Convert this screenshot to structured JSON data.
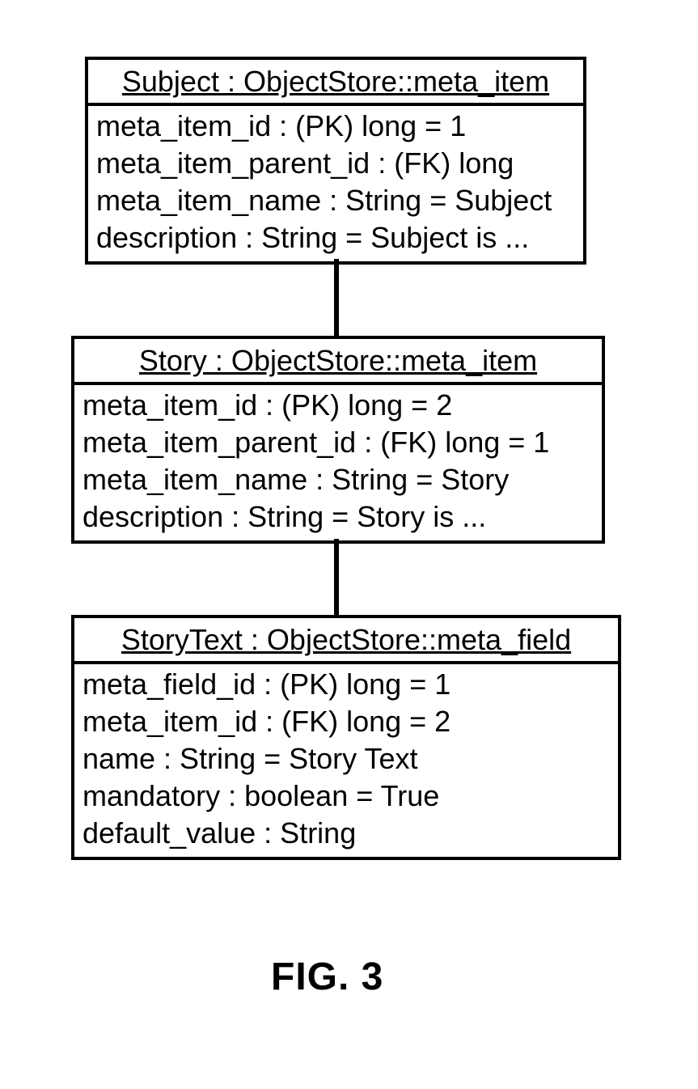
{
  "entities": [
    {
      "id": "subject",
      "header": "Subject : ObjectStore::meta_item",
      "attrs": [
        "meta_item_id : (PK) long = 1",
        "meta_item_parent_id : (FK) long",
        "meta_item_name : String = Subject",
        "description : String = Subject is ..."
      ]
    },
    {
      "id": "story",
      "header": "Story : ObjectStore::meta_item",
      "attrs": [
        "meta_item_id : (PK) long = 2",
        "meta_item_parent_id : (FK) long = 1",
        "meta_item_name : String = Story",
        "description : String = Story is ..."
      ]
    },
    {
      "id": "storytext",
      "header": "StoryText : ObjectStore::meta_field",
      "attrs": [
        "meta_field_id : (PK) long = 1",
        "meta_item_id : (FK) long = 2",
        "name : String = Story Text",
        "mandatory : boolean = True",
        "default_value : String"
      ]
    }
  ],
  "caption": "FIG. 3"
}
